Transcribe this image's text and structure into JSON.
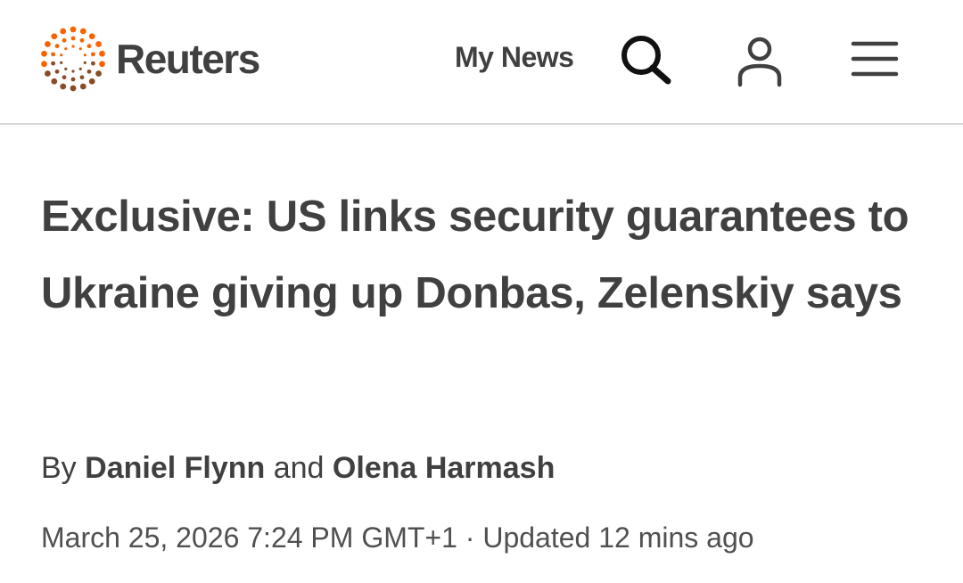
{
  "header": {
    "brand_name": "Reuters",
    "my_news_label": "My News",
    "search_icon": "search-icon",
    "account_icon": "user-icon",
    "menu_icon": "hamburger-menu-icon",
    "brand_colors": {
      "dot_orange": "#fa6400",
      "dot_brown": "#8a4b28",
      "text": "#404040"
    }
  },
  "article": {
    "headline": "Exclusive: US links security guarantees to Ukraine giving up Donbas, Zelenskiy says",
    "byline": {
      "prefix": "By",
      "author_1": "Daniel Flynn",
      "conjunction": "and",
      "author_2": "Olena Harmash"
    },
    "published": "March 25, 2026 7:24 PM GMT+1",
    "separator": "·",
    "updated": "Updated 12 mins ago"
  }
}
